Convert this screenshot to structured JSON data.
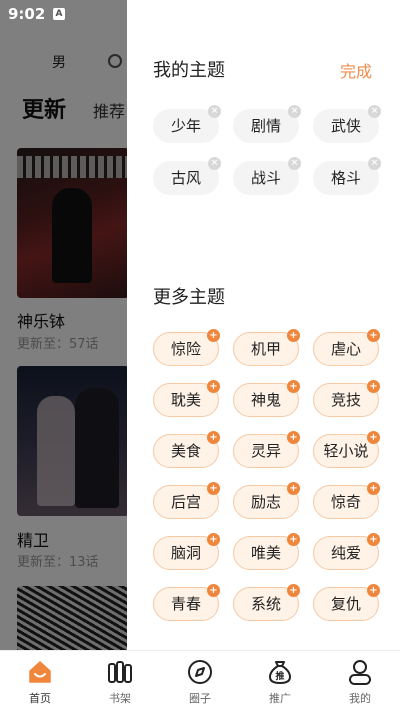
{
  "status": {
    "time": "9:02",
    "notification_icon": "A"
  },
  "background": {
    "gender_label": "男",
    "tab_active": "更新",
    "tab_other": "推荐",
    "books": [
      {
        "title": "神乐钵",
        "subtitle": "更新至：57话"
      },
      {
        "title": "精卫",
        "subtitle": "更新至：13话"
      }
    ]
  },
  "drawer": {
    "my_topics_title": "我的主题",
    "done_label": "完成",
    "my_topics": [
      "少年",
      "剧情",
      "武侠",
      "古风",
      "战斗",
      "格斗"
    ],
    "more_topics_title": "更多主题",
    "more_topics": [
      "惊险",
      "机甲",
      "虐心",
      "耽美",
      "神鬼",
      "竞技",
      "美食",
      "灵异",
      "轻小说",
      "后宫",
      "励志",
      "惊奇",
      "脑洞",
      "唯美",
      "纯爱",
      "青春",
      "系统",
      "复仇"
    ]
  },
  "tabbar": [
    {
      "label": "首页",
      "icon": "home-icon"
    },
    {
      "label": "书架",
      "icon": "bookshelf-icon"
    },
    {
      "label": "圈子",
      "icon": "compass-icon"
    },
    {
      "label": "推广",
      "icon": "promo-bag-icon"
    },
    {
      "label": "我的",
      "icon": "profile-icon"
    }
  ],
  "colors": {
    "accent": "#ef8c4a",
    "badge_plus": "#f0863c",
    "chip_more_bg": "#fff3e8"
  }
}
